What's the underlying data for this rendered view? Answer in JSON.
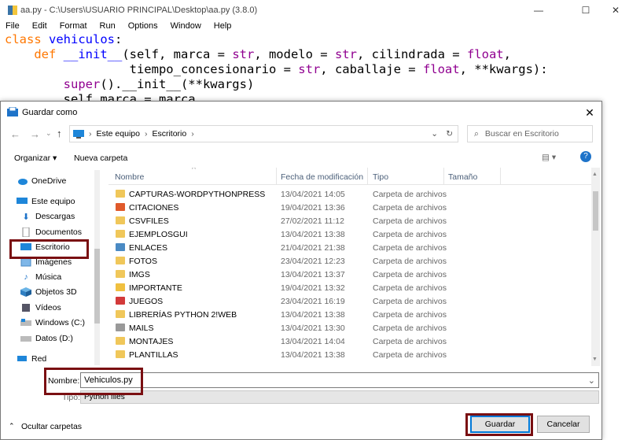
{
  "editor": {
    "title": "aa.py - C:\\Users\\USUARIO PRINCIPAL\\Desktop\\aa.py (3.8.0)",
    "menu": [
      "File",
      "Edit",
      "Format",
      "Run",
      "Options",
      "Window",
      "Help"
    ],
    "code": {
      "l1_kw": "class",
      "l1_name": " vehiculos",
      "l1_rest": ":",
      "l2_kw": "    def",
      "l2_name": " __init__",
      "l2_a": "(self, marca = ",
      "l2_b1": "str",
      "l2_c": ", modelo = ",
      "l2_b2": "str",
      "l2_d": ", cilindrada = ",
      "l2_b3": "float",
      "l2_e": ",",
      "l3_a": "                 tiempo_concesionario = ",
      "l3_b1": "str",
      "l3_c": ", caballaje = ",
      "l3_b2": "float",
      "l3_d": ", **kwargs):",
      "l4_a": "        ",
      "l4_b": "super",
      "l4_c": "().__init__(**kwargs)",
      "l5": "        self.marca = marca"
    }
  },
  "dialog": {
    "title": "Guardar como",
    "breadcrumb": [
      "Este equipo",
      "Escritorio"
    ],
    "search_placeholder": "Buscar en Escritorio",
    "toolbar": {
      "organize": "Organizar ▾",
      "new_folder": "Nueva carpeta"
    },
    "nav": [
      "OneDrive",
      "Este equipo",
      "Descargas",
      "Documentos",
      "Escritorio",
      "Imágenes",
      "Música",
      "Objetos 3D",
      "Vídeos",
      "Windows (C:)",
      "Datos (D:)",
      "Red"
    ],
    "columns": [
      "Nombre",
      "Fecha de modificación",
      "Tipo",
      "Tamaño"
    ],
    "files": [
      {
        "name": "CAPTURAS-WORDPYTHONPRESS",
        "date": "13/04/2021 14:05",
        "type": "Carpeta de archivos"
      },
      {
        "name": "CITACIONES",
        "date": "19/04/2021 13:36",
        "type": "Carpeta de archivos"
      },
      {
        "name": "CSVFILES",
        "date": "27/02/2021 11:12",
        "type": "Carpeta de archivos"
      },
      {
        "name": "EJEMPLOSGUI",
        "date": "13/04/2021 13:38",
        "type": "Carpeta de archivos"
      },
      {
        "name": "ENLACES",
        "date": "21/04/2021 21:38",
        "type": "Carpeta de archivos"
      },
      {
        "name": "FOTOS",
        "date": "23/04/2021 12:23",
        "type": "Carpeta de archivos"
      },
      {
        "name": "IMGS",
        "date": "13/04/2021 13:37",
        "type": "Carpeta de archivos"
      },
      {
        "name": "IMPORTANTE",
        "date": "19/04/2021 13:32",
        "type": "Carpeta de archivos"
      },
      {
        "name": "JUEGOS",
        "date": "23/04/2021 16:19",
        "type": "Carpeta de archivos"
      },
      {
        "name": "LIBRERÍAS PYTHON 2!WEB",
        "date": "13/04/2021 13:38",
        "type": "Carpeta de archivos"
      },
      {
        "name": "MAILS",
        "date": "13/04/2021 13:30",
        "type": "Carpeta de archivos"
      },
      {
        "name": "MONTAJES",
        "date": "13/04/2021 14:04",
        "type": "Carpeta de archivos"
      },
      {
        "name": "PLANTILLAS",
        "date": "13/04/2021 13:38",
        "type": "Carpeta de archivos"
      }
    ],
    "name_label": "Nombre:",
    "name_value": "Vehiculos.py",
    "type_label": "Tipo:",
    "type_value": "Python files",
    "hide_folders": "Ocultar carpetas",
    "save": "Guardar",
    "cancel": "Cancelar"
  },
  "colors": {
    "highlight": "#7a0f12",
    "accent": "#0078d7"
  }
}
